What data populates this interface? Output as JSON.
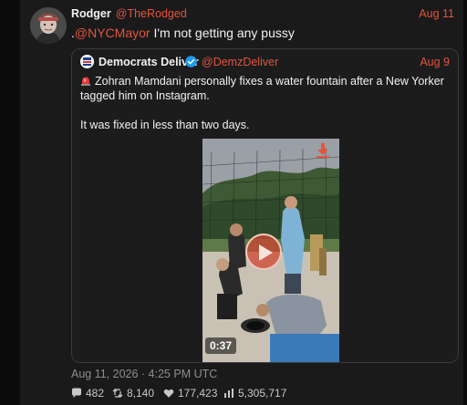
{
  "post": {
    "author_name": "Rodger",
    "author_handle": "@TheRodged",
    "date": "Aug 11",
    "mention": "@NYCMayor",
    "mention_prefix": ".",
    "text_rest": " I'm not getting any pussy",
    "timestamp": "Aug 11, 2026 · 4:25 PM UTC"
  },
  "quote": {
    "author_name": "Democrats Deliver",
    "author_handle": "@DemzDeliver",
    "date": "Aug 9",
    "line1": "Zohran Mamdani personally fixes a water fountain after a New Yorker tagged him on Instagram.",
    "line2": "It was fixed in less than two days.",
    "video_duration": "0:37"
  },
  "stats": {
    "replies": "482",
    "reposts": "8,140",
    "likes": "177,423",
    "views": "5,305,717"
  },
  "icons": {
    "replies": "speech-bubble-icon",
    "reposts": "repost-arrows-icon",
    "likes": "heart-icon",
    "views": "bar-chart-icon",
    "download": "download-arrow-icon",
    "play": "play-icon",
    "verified": "verified-badge-icon",
    "siren": "siren-emoji-icon"
  },
  "colors": {
    "accent": "#e5533d",
    "background": "#1a1a1b",
    "text": "#f2f2f2",
    "muted": "#8e8e93"
  }
}
